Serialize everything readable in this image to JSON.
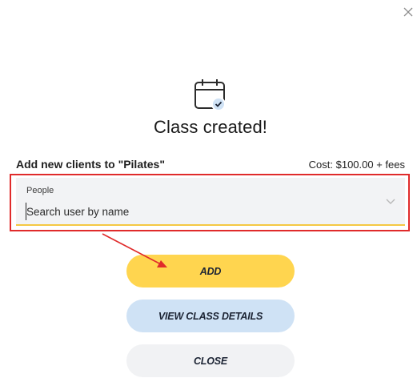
{
  "modal": {
    "close_icon": "close-icon",
    "status_icon": "calendar-check-icon",
    "title": "Class created!",
    "add_clients_label": "Add new clients to \"Pilates\"",
    "cost_text": "Cost: $100.00 + fees",
    "people_field": {
      "label": "People",
      "placeholder": "Search user by name",
      "value": "",
      "dropdown_icon": "chevron-down-icon"
    },
    "buttons": {
      "add": "ADD",
      "view_details": "VIEW CLASS DETAILS",
      "close": "CLOSE"
    }
  },
  "colors": {
    "accent_yellow": "#ffd54f",
    "light_blue": "#cfe2f5",
    "light_gray": "#f1f2f4",
    "annotation_red": "#e02b2b"
  }
}
